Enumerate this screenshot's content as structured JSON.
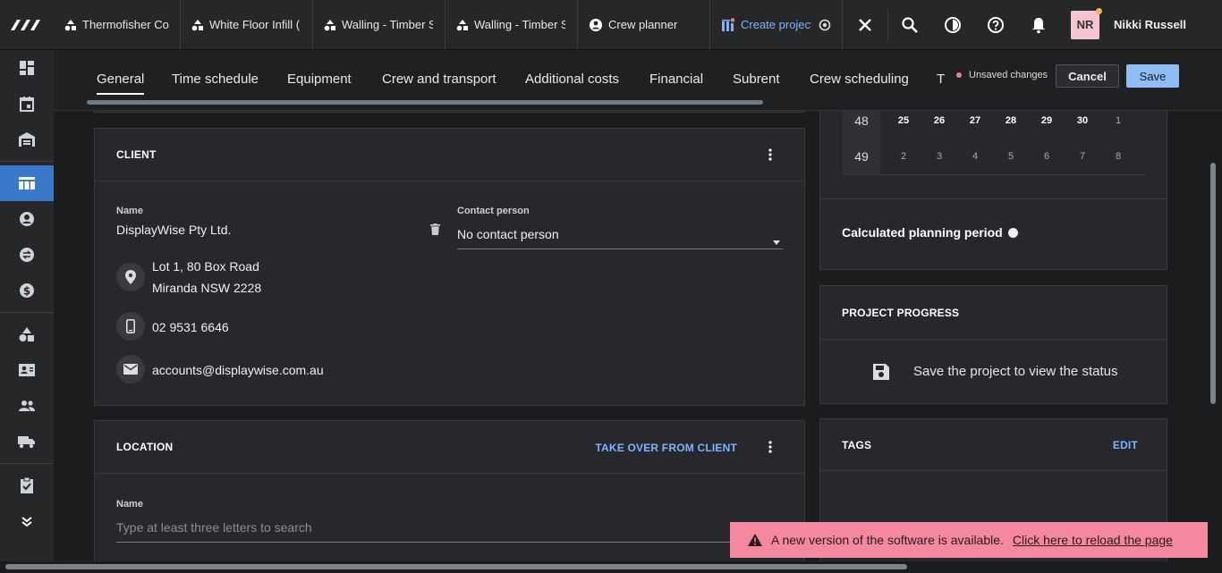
{
  "topbar": {
    "tabs": [
      {
        "label": "Thermofisher Cou",
        "icon": "shapes-icon"
      },
      {
        "label": "White Floor Infill (",
        "icon": "shapes-icon"
      },
      {
        "label": "Walling - Timber S",
        "icon": "shapes-icon"
      },
      {
        "label": "Walling - Timber S",
        "icon": "shapes-icon"
      },
      {
        "label": "Crew planner",
        "icon": "user-circle-icon"
      },
      {
        "label": "Create project",
        "icon": "project-add-icon",
        "active": true
      }
    ],
    "user": {
      "initials": "NR",
      "name": "Nikki Russell"
    }
  },
  "subtabs": [
    "General",
    "Time schedule",
    "Equipment",
    "Crew and transport",
    "Additional costs",
    "Financial",
    "Subrent",
    "Crew scheduling",
    "T"
  ],
  "status": {
    "unsaved": "Unsaved changes",
    "cancel": "Cancel",
    "save": "Save"
  },
  "calendar": {
    "rows": [
      {
        "week": "48",
        "days": [
          "25",
          "26",
          "27",
          "28",
          "29",
          "30",
          "1"
        ],
        "bold": [
          true,
          true,
          true,
          true,
          true,
          true,
          false
        ]
      },
      {
        "week": "49",
        "days": [
          "2",
          "3",
          "4",
          "5",
          "6",
          "7",
          "8"
        ],
        "bold": [
          false,
          false,
          false,
          false,
          false,
          false,
          false
        ]
      }
    ],
    "planning_label": "Calculated planning period"
  },
  "client": {
    "title": "CLIENT",
    "name_label": "Name",
    "name_value": "DisplayWise Pty Ltd.",
    "contact_label": "Contact person",
    "contact_value": "No contact person",
    "address_line1": "Lot 1, 80 Box Road",
    "address_line2": "Miranda NSW 2228",
    "phone": "02 9531 6646",
    "email": "accounts@displaywise.com.au"
  },
  "location": {
    "title": "LOCATION",
    "takeover": "TAKE OVER FROM CLIENT",
    "name_label": "Name",
    "name_placeholder": "Type at least three letters to search"
  },
  "progress": {
    "title": "PROJECT PROGRESS",
    "message": "Save the project to view the status"
  },
  "tags": {
    "title": "TAGS",
    "edit": "EDIT"
  },
  "toast": {
    "message": "A new version of the software is available.",
    "link": "Click here to reload the page"
  },
  "colors": {
    "accent": "#3a79c9",
    "link": "#7fb2ff",
    "toast": "#f4889f",
    "save": "#8fbcf3"
  }
}
